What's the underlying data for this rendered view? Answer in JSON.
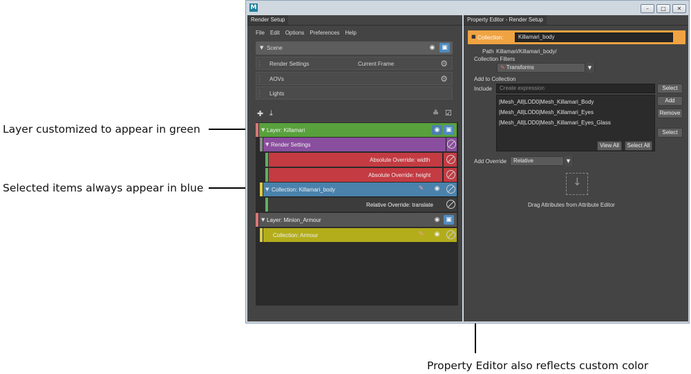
{
  "annotations": {
    "layer_green": "Layer customized to appear in green",
    "selected_blue": "Selected items always appear in blue",
    "property_editor": "Property Editor also reflects custom color"
  },
  "window": {
    "logo": "M",
    "minimize": "–",
    "maximize": "□",
    "close": "✕"
  },
  "render_setup": {
    "tab": "Render Setup",
    "menu": [
      "File",
      "Edit",
      "Options",
      "Preferences",
      "Help"
    ],
    "scene_label": "Scene",
    "render_settings_label": "Render Settings",
    "current_frame_label": "Current Frame",
    "aovs_label": "AOVs",
    "lights_label": "Lights",
    "tree": {
      "layer1": "Layer:  Killamari",
      "render_settings": "Render Settings",
      "override_width": "Absolute Override:  width",
      "override_height": "Absolute Override:  height",
      "collection_body": "Collection:  Killamari_body",
      "relative_override": "Relative Override:  translate",
      "layer2": "Layer:  Minion_Armour",
      "collection_armour": "Collection:  Armour"
    },
    "colors": {
      "layer_green": "#58a13c",
      "render_settings_purple": "#8a4e9e",
      "override_red": "#c43b42",
      "selected_blue": "#4a82ac",
      "collection_yellow": "#b3ad1b",
      "layer_gray": "#555555"
    }
  },
  "property_editor": {
    "tab": "Property Editor - Render Setup",
    "collection_label": "Collection:",
    "collection_name": "Killamari_body",
    "path_label": "Path",
    "path_value": "Killamari/Killamari_body/",
    "filters_label": "Collection Filters",
    "filter_value": "Transforms",
    "add_to_collection": "Add to Collection",
    "include_label": "Include",
    "include_placeholder": "Create expression",
    "select_btn": "Select",
    "add_btn": "Add",
    "remove_btn": "Remove",
    "select_btn2": "Select",
    "items": [
      "|Mesh_All|LOD0|Mesh_Killamari_Body",
      "|Mesh_All|LOD0|Mesh_Killamari_Eyes",
      "|Mesh_All|LOD0|Mesh_Killamari_Eyes_Glass"
    ],
    "view_all": "View All",
    "select_all": "Select All",
    "add_override_label": "Add Override",
    "override_mode": "Relative",
    "drag_hint": "Drag Attributes from Attribute Editor",
    "accent_orange": "#f0a342"
  }
}
